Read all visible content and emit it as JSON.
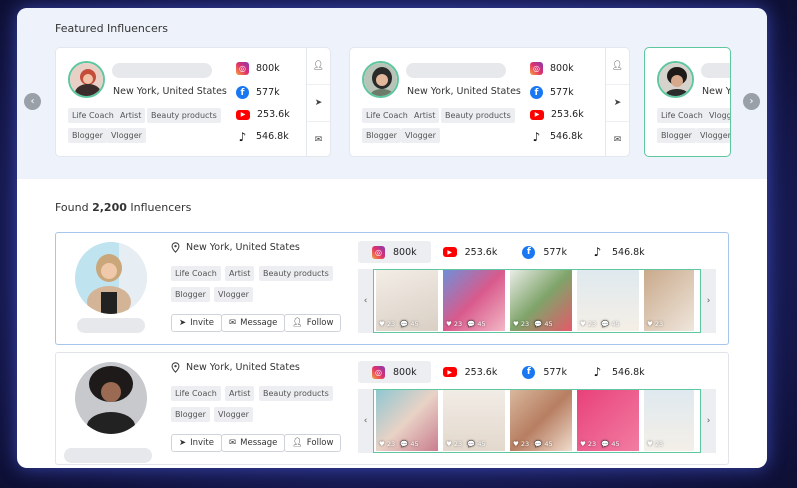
{
  "featured": {
    "title": "Featured Influencers",
    "cards": [
      {
        "location": "New York, United States",
        "tags": [
          "Life Coach",
          "Artist",
          "Beauty products",
          "Blogger",
          "Vlogger"
        ],
        "stats": {
          "instagram": "800k",
          "facebook": "577k",
          "youtube": "253.6k",
          "tiktok": "546.8k"
        }
      },
      {
        "location": "New York, United States",
        "tags": [
          "Life Coach",
          "Artist",
          "Beauty products",
          "Blogger",
          "Vlogger"
        ],
        "stats": {
          "instagram": "800k",
          "facebook": "577k",
          "youtube": "253.6k",
          "tiktok": "546.8k"
        }
      },
      {
        "location": "New Y",
        "tags": [
          "Life Coach",
          "Vlogger",
          "Blogger",
          "Vloggerr"
        ]
      }
    ],
    "prev_icon": "‹",
    "next_icon": "›"
  },
  "found": {
    "prefix": "Found ",
    "count": "2,200",
    "suffix": " Influencers"
  },
  "rows": [
    {
      "location": "New York, United States",
      "tags": [
        "Life Coach",
        "Artist",
        "Beauty products",
        "Blogger",
        "Vlogger"
      ],
      "buttons": {
        "invite": "Invite",
        "message": "Message",
        "follow": "Follow"
      },
      "stats": {
        "instagram": "800k",
        "youtube": "253.6k",
        "facebook": "577k",
        "tiktok": "546.8k"
      },
      "photos": [
        {
          "likes": "23",
          "comments": "45"
        },
        {
          "likes": "23",
          "comments": "45"
        },
        {
          "likes": "23",
          "comments": "45"
        },
        {
          "likes": "23",
          "comments": "45"
        },
        {
          "likes": "23",
          "comments": "45"
        }
      ]
    },
    {
      "location": "New York, United States",
      "tags": [
        "Life Coach",
        "Artist",
        "Beauty products",
        "Blogger",
        "Vlogger"
      ],
      "buttons": {
        "invite": "Invite",
        "message": "Message",
        "follow": "Follow"
      },
      "stats": {
        "instagram": "800k",
        "youtube": "253.6k",
        "facebook": "577k",
        "tiktok": "546.8k"
      },
      "photos": [
        {
          "likes": "23",
          "comments": "45"
        },
        {
          "likes": "23",
          "comments": "45"
        },
        {
          "likes": "23",
          "comments": "45"
        },
        {
          "likes": "23",
          "comments": "45"
        },
        {
          "likes": "23",
          "comments": "45"
        }
      ]
    }
  ],
  "colors": {
    "accent_green": "#5ec7a0",
    "active_blue": "#a6c6ee",
    "instagram": "#e1306c",
    "facebook": "#1877f2",
    "youtube": "#ff0000"
  }
}
